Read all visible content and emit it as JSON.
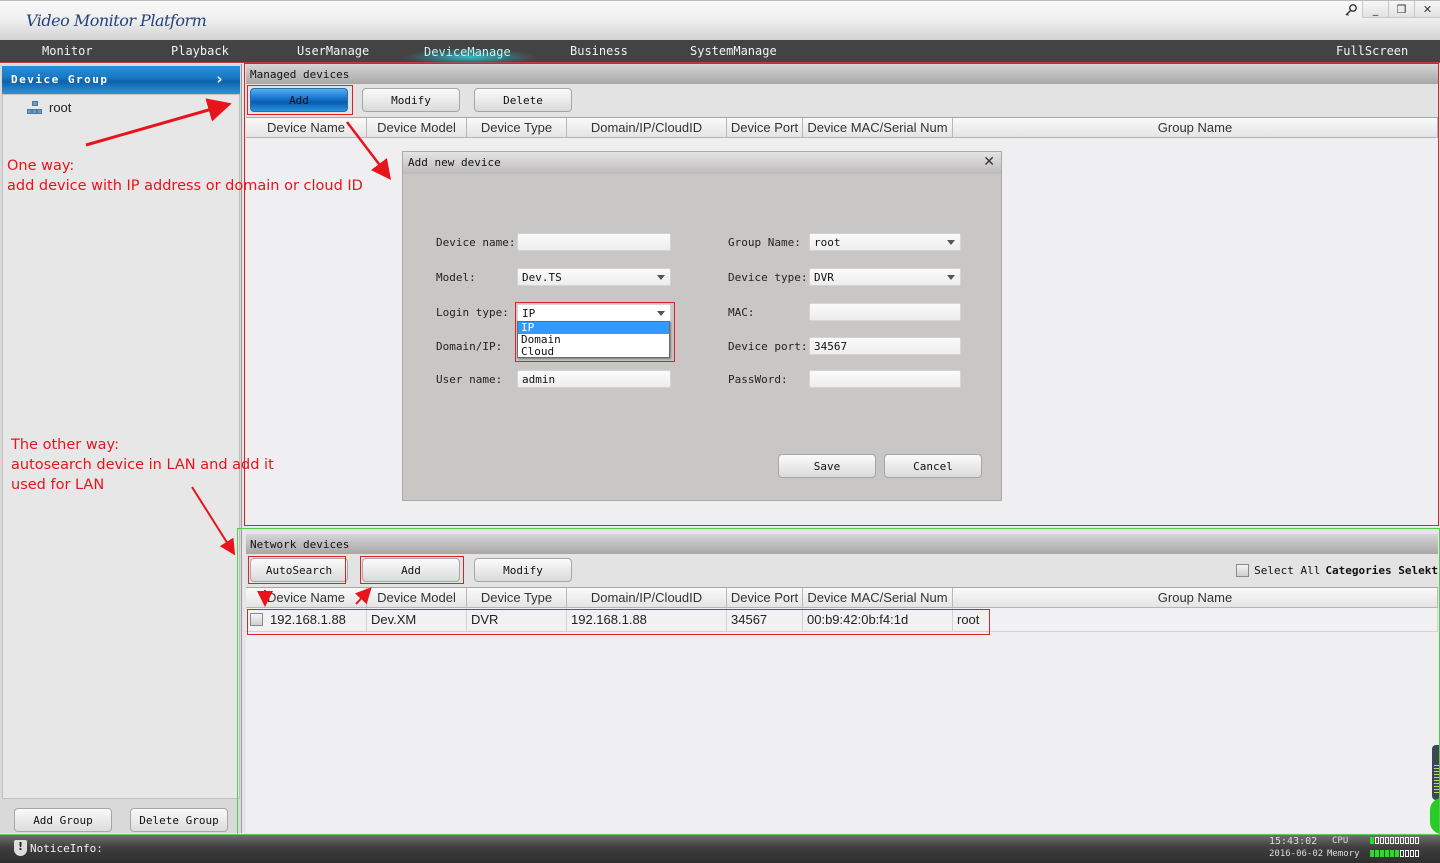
{
  "app": {
    "title": "Video Monitor Platform",
    "window_controls": {
      "key": "key-icon",
      "minimize": "_",
      "restore": "❐",
      "close": "✕"
    }
  },
  "nav": {
    "items": [
      {
        "label": "Monitor"
      },
      {
        "label": "Playback"
      },
      {
        "label": "UserManage"
      },
      {
        "label": "DeviceManage",
        "active": true
      },
      {
        "label": "Business"
      },
      {
        "label": "SystemManage"
      }
    ],
    "fullscreen": "FullScreen"
  },
  "sidebar": {
    "header": "Device Group",
    "chevron": "›",
    "tree": [
      {
        "label": "root",
        "icon": "network-tree-icon"
      }
    ],
    "add_group": "Add Group",
    "delete_group": "Delete Group"
  },
  "managed": {
    "title": "Managed devices",
    "buttons": {
      "add": "Add",
      "modify": "Modify",
      "delete": "Delete"
    },
    "columns": [
      "Device Name",
      "Device Model",
      "Device Type",
      "Domain/IP/CloudID",
      "Device Port",
      "Device MAC/Serial Num",
      "Group Name"
    ],
    "rows": []
  },
  "dialog": {
    "title": "Add new device",
    "close": "✕",
    "fields": {
      "device_name": {
        "label": "Device name:",
        "value": ""
      },
      "model": {
        "label": "Model:",
        "value": "Dev.TS"
      },
      "login_type": {
        "label": "Login type:",
        "value": "IP",
        "options": [
          "IP",
          "Domain",
          "Cloud"
        ],
        "highlighted": "IP"
      },
      "domain_ip": {
        "label": "Domain/IP:",
        "value": ""
      },
      "user_name": {
        "label": "User name:",
        "value": "admin"
      },
      "group_name": {
        "label": "Group Name:",
        "value": "root"
      },
      "device_type": {
        "label": "Device type:",
        "value": "DVR"
      },
      "mac": {
        "label": "MAC:",
        "value": ""
      },
      "device_port": {
        "label": "Device port:",
        "value": "34567"
      },
      "password": {
        "label": "PassWord:",
        "value": ""
      }
    },
    "save": "Save",
    "cancel": "Cancel"
  },
  "network": {
    "title": "Network devices",
    "buttons": {
      "autosearch": "AutoSearch",
      "add": "Add",
      "modify": "Modify"
    },
    "select_all": "Select All",
    "categories_select": "Categories Selekt",
    "columns": [
      "Device Name",
      "Device Model",
      "Device Type",
      "Domain/IP/CloudID",
      "Device Port",
      "Device MAC/Serial Num",
      "Group Name"
    ],
    "rows": [
      {
        "checked": false,
        "device_name": "192.168.1.88",
        "device_model": "Dev.XM",
        "device_type": "DVR",
        "domain": "192.168.1.88",
        "port": "34567",
        "mac": "00:b9:42:0b:f4:1d",
        "group": "root"
      }
    ]
  },
  "annotations": {
    "one_way_title": "One way:",
    "one_way_text": "add device with IP address or domain or cloud ID",
    "other_way_title": "The other way:",
    "other_way_text1": "autosearch device in LAN and add it",
    "other_way_text2": "used for LAN",
    "color": "#e8141c"
  },
  "status": {
    "notice_label": "NoticeInfo:",
    "time": "15:43:02",
    "date": "2016-06-02",
    "cpu_label": "CPU",
    "memory_label": "Memory",
    "cpu_level": 0.1,
    "memory_level": 0.6
  },
  "colors": {
    "accent_red": "#d9232a",
    "accent_green": "#4fd14f",
    "nav_bg": "#434343",
    "group_header_blue": "#1a79c4",
    "selection_blue": "#3399ff"
  }
}
